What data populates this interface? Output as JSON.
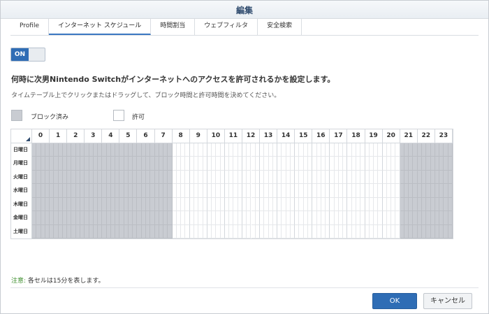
{
  "dialog": {
    "title": "編集"
  },
  "tabs": [
    {
      "label": "Profile",
      "active": false
    },
    {
      "label": "インターネット スケジュール",
      "active": true
    },
    {
      "label": "時間割当",
      "active": false
    },
    {
      "label": "ウェブフィルタ",
      "active": false
    },
    {
      "label": "安全検索",
      "active": false
    }
  ],
  "toggle": {
    "label": "ON",
    "state": "on"
  },
  "heading": "何時に次男Nintendo Switchがインターネットへのアクセスを許可されるかを設定します。",
  "subtext": "タイムテーブル上でクリックまたはドラッグして、ブロック時間と許可時間を決めてください。",
  "legend": {
    "blocked": "ブロック済み",
    "allowed": "許可"
  },
  "schedule": {
    "hours": [
      "0",
      "1",
      "2",
      "3",
      "4",
      "5",
      "6",
      "7",
      "8",
      "9",
      "10",
      "11",
      "12",
      "13",
      "14",
      "15",
      "16",
      "17",
      "18",
      "19",
      "20",
      "21",
      "22",
      "23"
    ],
    "days": [
      "日曜日",
      "月曜日",
      "火曜日",
      "水曜日",
      "木曜日",
      "金曜日",
      "土曜日"
    ],
    "slots_per_hour": 4,
    "blocked_hours": [
      0,
      1,
      2,
      3,
      4,
      5,
      6,
      7,
      21,
      22,
      23
    ]
  },
  "note": {
    "label": "注意:",
    "text": " 各セルは15分を表します。"
  },
  "buttons": {
    "ok": "OK",
    "cancel": "キャンセル"
  },
  "colors": {
    "accent": "#2f6db5",
    "blocked": "#c9ccd2",
    "allowed": "#ffffff",
    "note_label": "#3f8f2f"
  }
}
